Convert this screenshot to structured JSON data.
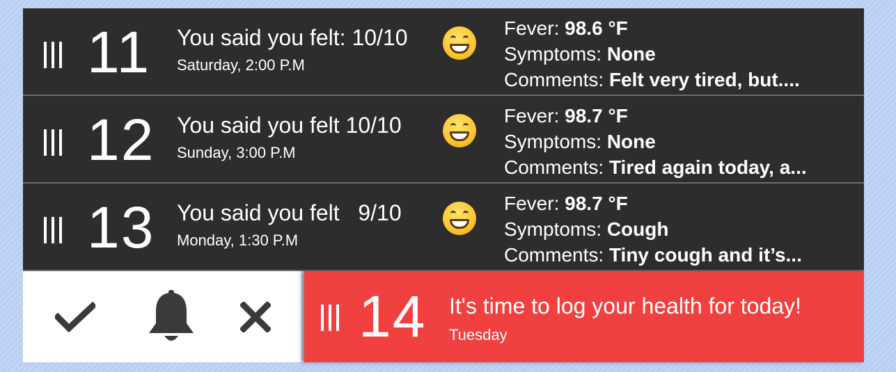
{
  "entries": [
    {
      "day": "11",
      "feeling": "You said you felt: 10/10",
      "when": "Saturday, 2:00 P.M",
      "fever_label": "Fever:",
      "fever_value": "98.6 °F",
      "symptoms_label": "Symptoms:",
      "symptoms_value": "None",
      "comments_label": "Comments:",
      "comments_value": "Felt very tired, but...."
    },
    {
      "day": "12",
      "feeling": "You said you felt 10/10",
      "when": "Sunday, 3:00 P.M",
      "fever_label": "Fever:",
      "fever_value": "98.7 °F",
      "symptoms_label": "Symptoms:",
      "symptoms_value": "None",
      "comments_label": "Comments:",
      "comments_value": "Tired again today, a..."
    },
    {
      "day": "13",
      "feeling": "You said you felt   9/10",
      "when": "Monday, 1:30 P.M",
      "fever_label": "Fever:",
      "fever_value": "98.7 °F",
      "symptoms_label": "Symptoms:",
      "symptoms_value": "Cough",
      "comments_label": "Comments:",
      "comments_value": "Tiny cough and it’s..."
    }
  ],
  "icons": {
    "emoji": "grinning-face-icon",
    "grip": "drag-handle-icon",
    "check": "checkmark-icon",
    "bell": "bell-icon",
    "close": "close-icon"
  },
  "notification": {
    "day": "14",
    "message": "It's time to log your health for today!",
    "subtitle": "Tuesday"
  },
  "colors": {
    "row_background": "#2d2d2d",
    "notification_red": "#f0403f",
    "action_icon": "#3a3a3a",
    "page_background": "#c3d6f7"
  }
}
